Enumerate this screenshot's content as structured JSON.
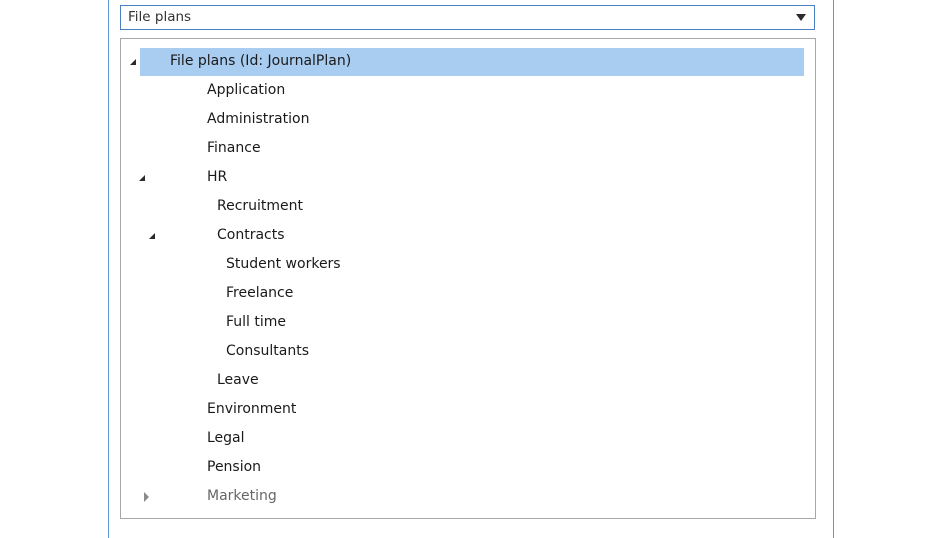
{
  "combo": {
    "value": "File plans"
  },
  "tree": {
    "items": [
      {
        "label": "File plans (Id: JournalPlan)",
        "state": "expanded",
        "selected": true
      },
      {
        "label": "Application"
      },
      {
        "label": "Administration"
      },
      {
        "label": "Finance"
      },
      {
        "label": "HR",
        "state": "expanded"
      },
      {
        "label": "Recruitment"
      },
      {
        "label": "Contracts",
        "state": "expanded"
      },
      {
        "label": "Student workers"
      },
      {
        "label": "Freelance"
      },
      {
        "label": "Full time"
      },
      {
        "label": "Consultants"
      },
      {
        "label": "Leave"
      },
      {
        "label": "Environment"
      },
      {
        "label": "Legal"
      },
      {
        "label": "Pension"
      },
      {
        "label": "Marketing",
        "state": "collapsed"
      }
    ]
  },
  "colors": {
    "selection": "#a9cdf1",
    "combo_border": "#4a7fc1",
    "frame_border": "#5b9bd5",
    "tree_border": "#a8a8a8"
  }
}
